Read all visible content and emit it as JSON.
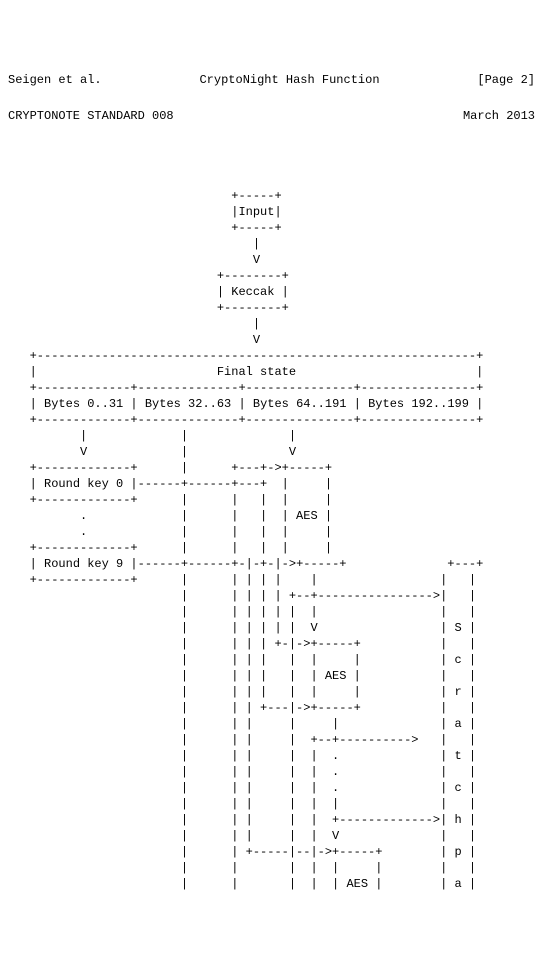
{
  "header": {
    "author": "Seigen et al.",
    "title": "CryptoNight Hash Function",
    "page": "[Page 2]"
  },
  "subheader": {
    "standard": "CRYPTONOTE STANDARD 008",
    "date": "March 2013"
  },
  "diagram": {
    "input_label": "Input",
    "keccak_label": "Keccak",
    "final_state_label": "Final state",
    "bytes_col1": "Bytes 0..31",
    "bytes_col2": "Bytes 32..63",
    "bytes_col3": "Bytes 64..191",
    "bytes_col4": "Bytes 192..199",
    "round_key_0": "Round key 0",
    "round_key_9": "Round key 9",
    "aes_label": "AES",
    "scratchpad_letters": [
      "S",
      "c",
      "r",
      "a",
      "t",
      "c",
      "h",
      "p",
      "a"
    ]
  }
}
